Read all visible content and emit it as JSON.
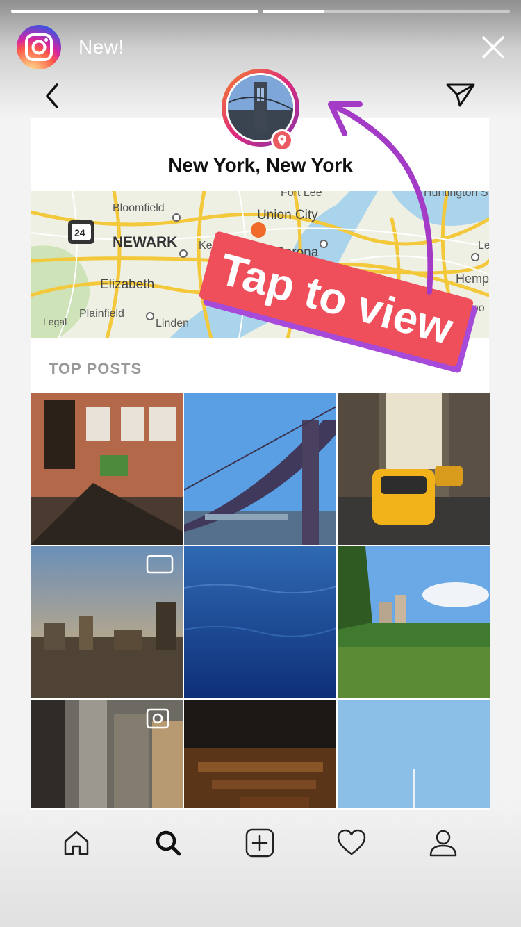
{
  "story": {
    "label": "New!",
    "progress": [
      1.0,
      0.25
    ]
  },
  "header": {
    "location": "New York, New York"
  },
  "map": {
    "labels": [
      "Bloomfield",
      "Fort Lee",
      "Union City",
      "NEWARK",
      "Ke",
      "Corona",
      "Elizabeth",
      "Plainfield",
      "Linden",
      "Legal",
      "Huntington S",
      "Le",
      "Hempst",
      "eepo",
      "24"
    ]
  },
  "sticker": {
    "text": "Tap to view"
  },
  "section": {
    "top_posts": "TOP POSTS"
  },
  "tabs": [
    "home-icon",
    "search-icon",
    "add-post-icon",
    "heart-icon",
    "profile-icon"
  ],
  "colors": {
    "sticker_red": "#ee4f5a",
    "sticker_purple": "#a64bd9",
    "arrow_purple": "#a33bc6"
  }
}
